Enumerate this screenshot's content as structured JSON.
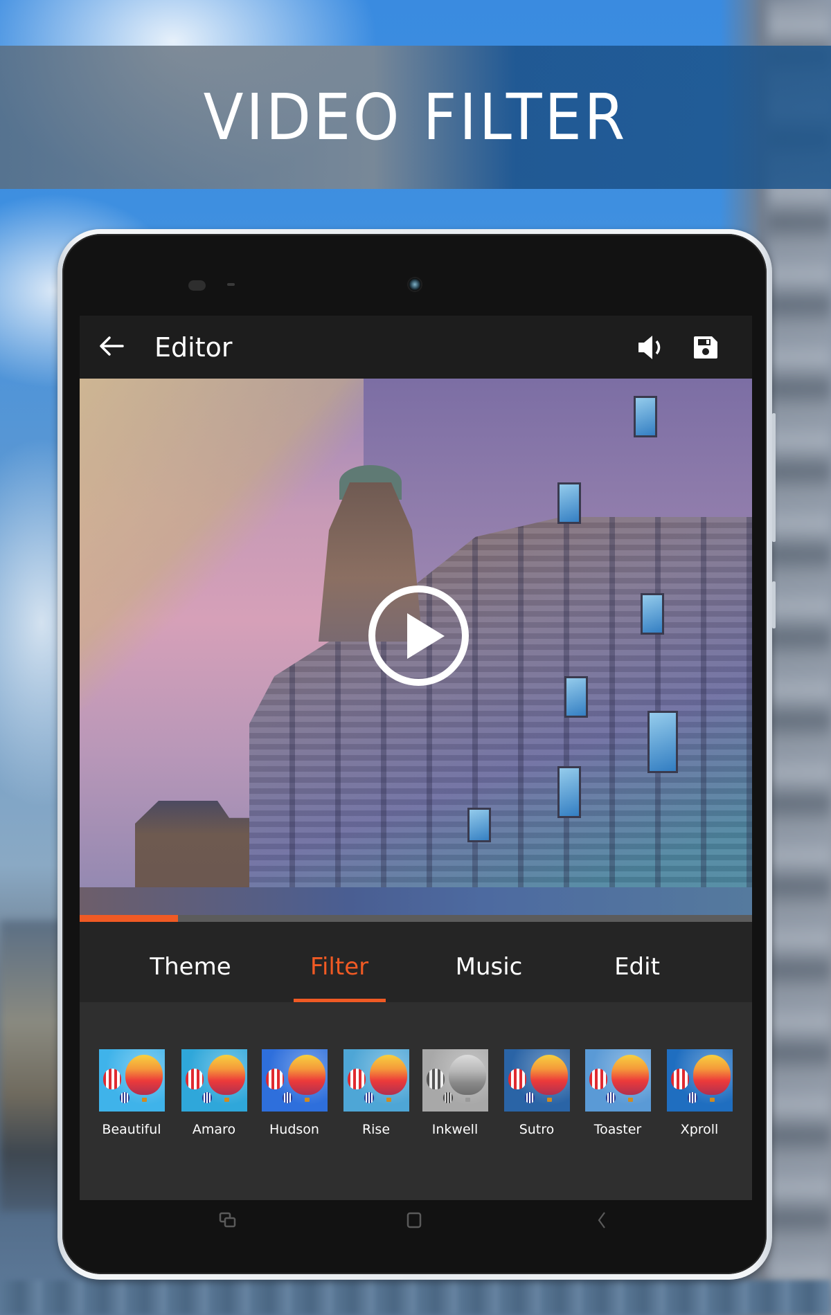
{
  "banner": {
    "title": "VIDEO FILTER"
  },
  "device": {
    "side_buttons": [
      "volume",
      "power"
    ]
  },
  "app": {
    "toolbar": {
      "title": "Editor",
      "back_icon": "arrow-left-icon",
      "volume_icon": "volume-icon",
      "save_icon": "floppy-disk-icon"
    },
    "video": {
      "play_icon": "play-circle-icon",
      "progress_fraction": 0.146
    },
    "colors": {
      "accent": "#F05A24",
      "toolbar_bg": "#1D1D1D",
      "tabs_bg": "#252525",
      "panel_bg": "#2F2F2F",
      "text": "#FFFFFF"
    },
    "tabs": [
      {
        "label": "Theme",
        "active": false
      },
      {
        "label": "Filter",
        "active": true
      },
      {
        "label": "Music",
        "active": false
      },
      {
        "label": "Edit",
        "active": false
      }
    ],
    "filters": [
      {
        "label": "Beautiful",
        "tint": "#3FB3EA"
      },
      {
        "label": "Amaro",
        "tint": "#2FA7DA"
      },
      {
        "label": "Hudson",
        "tint": "#2E6FDC"
      },
      {
        "label": "Rise",
        "tint": "#4EA6D6"
      },
      {
        "label": "Inkwell",
        "tint": "#A8A8A8"
      },
      {
        "label": "Sutro",
        "tint": "#2A64A6"
      },
      {
        "label": "Toaster",
        "tint": "#5A9AD6"
      },
      {
        "label": "Xproll",
        "tint": "#1F6EC0"
      }
    ]
  },
  "navbar": {
    "recents_icon": "recent-apps-icon",
    "home_icon": "home-icon",
    "back_icon": "nav-back-icon"
  }
}
